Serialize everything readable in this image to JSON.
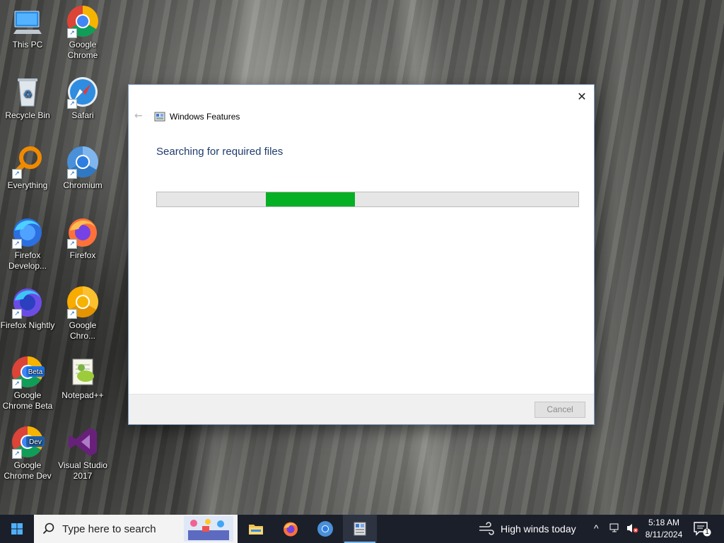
{
  "desktop": {
    "icons": [
      {
        "label": "This PC",
        "icon": "this-pc-icon"
      },
      {
        "label": "Google Chrome",
        "icon": "chrome-icon"
      },
      {
        "label": "Recycle Bin",
        "icon": "recycle-bin-icon"
      },
      {
        "label": "Safari",
        "icon": "safari-icon"
      },
      {
        "label": "Everything",
        "icon": "everything-icon"
      },
      {
        "label": "Chromium",
        "icon": "chromium-icon"
      },
      {
        "label": "Firefox Develop...",
        "icon": "firefox-developer-icon"
      },
      {
        "label": "Firefox",
        "icon": "firefox-icon"
      },
      {
        "label": "Firefox Nightly",
        "icon": "firefox-nightly-icon"
      },
      {
        "label": "Google Chro...",
        "icon": "chrome-canary-icon"
      },
      {
        "label": "Google Chrome Beta",
        "icon": "chrome-beta-icon",
        "badge": "Beta"
      },
      {
        "label": "Notepad++",
        "icon": "notepadpp-icon"
      },
      {
        "label": "Google Chrome Dev",
        "icon": "chrome-dev-icon",
        "badge": "Dev"
      },
      {
        "label": "Visual Studio 2017",
        "icon": "visual-studio-icon"
      }
    ]
  },
  "dialog": {
    "title": "Windows Features",
    "close_glyph": "✕",
    "back_glyph": "←",
    "heading": "Searching for required files",
    "progress": {
      "start_fraction": 0.258,
      "end_fraction": 0.47,
      "color": "#06b025",
      "indeterminate": true
    },
    "cancel_label": "Cancel"
  },
  "taskbar": {
    "search_placeholder": "Type here to search",
    "apps": [
      "file-explorer-icon",
      "firefox-icon",
      "chromium-icon",
      "windows-features-icon"
    ],
    "weather_text": "High winds today",
    "time": "5:18 AM",
    "date": "8/11/2024",
    "notification_count": "1"
  },
  "colors": {
    "heading_blue": "#1e3c6e",
    "taskbar_bg": "#1b1f2a",
    "progress_green": "#06b025"
  }
}
